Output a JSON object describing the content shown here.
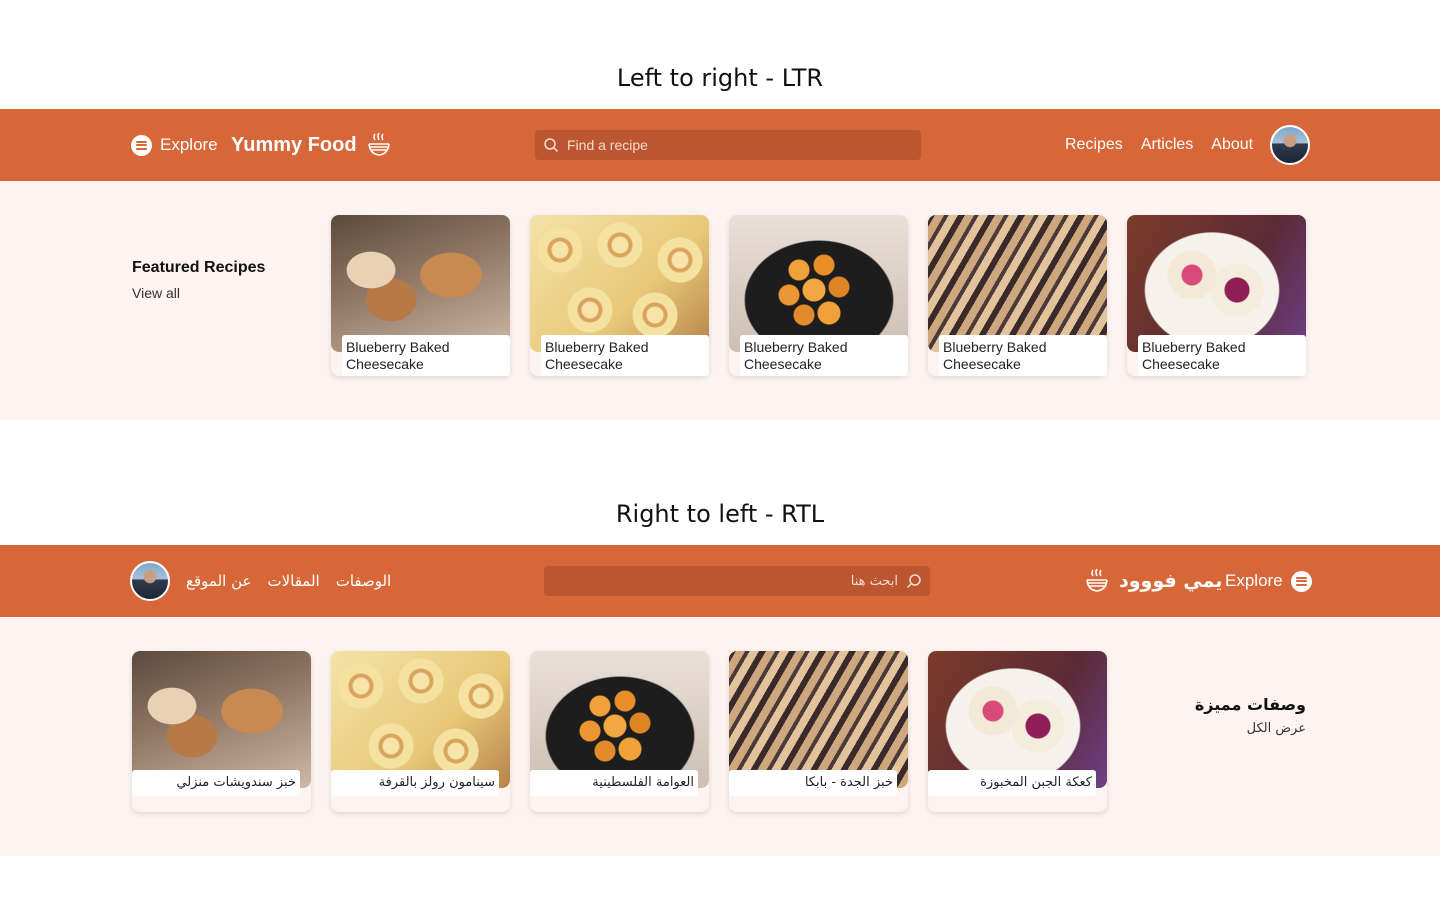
{
  "ltr": {
    "section_title": "Left to right - LTR",
    "nav": {
      "explore_label": "Explore",
      "brand": "Yummy Food",
      "search_placeholder": "Find a recipe",
      "links": [
        "Recipes",
        "Articles",
        "About"
      ]
    },
    "featured": {
      "title": "Featured Recipes",
      "view_all": "View all",
      "cards": [
        {
          "title": "Blueberry Baked Cheesecake",
          "image": "bread"
        },
        {
          "title": "Blueberry Baked Cheesecake",
          "image": "cinnamon-rolls"
        },
        {
          "title": "Blueberry Baked Cheesecake",
          "image": "awameh"
        },
        {
          "title": "Blueberry Baked Cheesecake",
          "image": "babka"
        },
        {
          "title": "Blueberry Baked Cheesecake",
          "image": "cheesecake"
        }
      ]
    }
  },
  "rtl": {
    "section_title": "Right to left - RTL",
    "nav": {
      "explore_label": "Explore",
      "brand": "يمي فووود",
      "search_placeholder": "ابحث هنا",
      "links": [
        "الوصفات",
        "المقالات",
        "عن الموقع"
      ]
    },
    "featured": {
      "title": "وصفات مميزة",
      "view_all": "عرض الكل",
      "cards": [
        {
          "title": "كعكة الجبن المخبوزة",
          "image": "cheesecake"
        },
        {
          "title": "خبز الجدة - بابكا",
          "image": "babka"
        },
        {
          "title": "العوامة الفلسطينية",
          "image": "awameh"
        },
        {
          "title": "سينامون رولز بالقرفة",
          "image": "cinnamon-rolls"
        },
        {
          "title": "خبز سندويشات منزلي",
          "image": "bread"
        }
      ]
    }
  },
  "colors": {
    "navbar": "#d76638",
    "search_bg": "#bb5630",
    "band_bg": "#fdf4f1"
  }
}
